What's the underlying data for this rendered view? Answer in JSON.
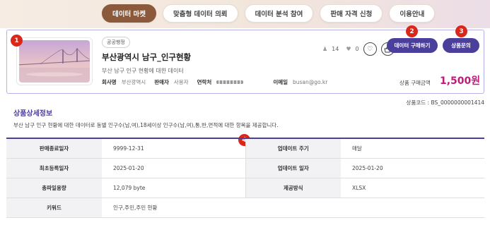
{
  "tabs": [
    {
      "label": "데이터 마켓",
      "active": true
    },
    {
      "label": "맞춤형 데이터 의뢰",
      "active": false
    },
    {
      "label": "데이터 분석 참여",
      "active": false
    },
    {
      "label": "판매 자격 신청",
      "active": false
    },
    {
      "label": "이용안내",
      "active": false
    }
  ],
  "product": {
    "category": "공공행정",
    "title": "부산광역시 남구_인구현황",
    "description": "부산 남구 인구 현황에 대한 데이터",
    "company_label": "회사명",
    "company": "부산광역시",
    "seller_label": "판매자",
    "seller": "사용자",
    "contact_label": "연락처",
    "email_label": "이메일",
    "email": "busan@go.kr",
    "views": "14",
    "likes": "0",
    "buy_button": "데이터 구매하기",
    "inquiry_button": "상품문의",
    "price_label": "상품 구매금액",
    "price": "1,500원"
  },
  "badges": [
    "1",
    "2",
    "3",
    "4"
  ],
  "product_code": "상품코드 : BS_0000000001414",
  "detail": {
    "title": "상품상세정보",
    "description": "부산 남구 인구 현황에 대한 데이터로 동별 인구수(남,여),18세이상 인구수(남,여),통,반,면적에 대한 항목을 제공합니다."
  },
  "info_rows": [
    {
      "k1": "판매종료일자",
      "v1": "9999-12-31",
      "k2": "업데이트 주기",
      "v2": "매달"
    },
    {
      "k1": "최초등록일자",
      "v1": "2025-01-20",
      "k2": "업데이트 일자",
      "v2": "2025-01-20"
    },
    {
      "k1": "총파일용량",
      "v1": "12,079 byte",
      "k2": "제공방식",
      "v2": "XLSX"
    },
    {
      "k1": "키워드",
      "v1": "인구,주민,주민 현황"
    }
  ],
  "colors": {
    "accent": "#4b3f9c",
    "price": "#c2187c",
    "badge": "#d9271a",
    "active_tab": "#8b5a3c"
  },
  "icons": {
    "views": "user-icon",
    "likes": "heart-icon",
    "wish": "heart-outline-icon",
    "cart": "basket-icon"
  }
}
